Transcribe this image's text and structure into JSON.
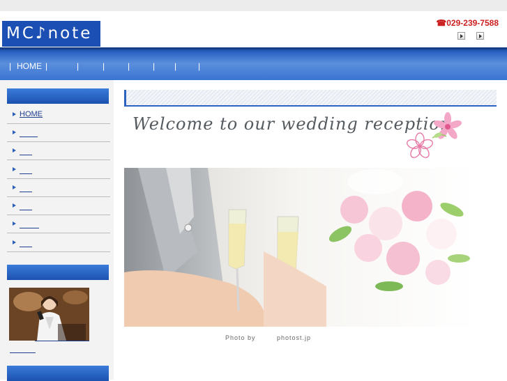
{
  "header": {
    "logo_text": "MC♪note",
    "phone": "☎029-239-7588"
  },
  "nav": {
    "home_label": "HOME",
    "separator": "|"
  },
  "sidebar": {
    "items": [
      {
        "label": "HOME"
      }
    ]
  },
  "main": {
    "welcome_text": "Welcome to our wedding reception",
    "credit_left": "Photo by",
    "credit_right": "photost.jp"
  },
  "colors": {
    "brand_blue": "#1c4fb3",
    "phone_red": "#cc1f1f"
  }
}
